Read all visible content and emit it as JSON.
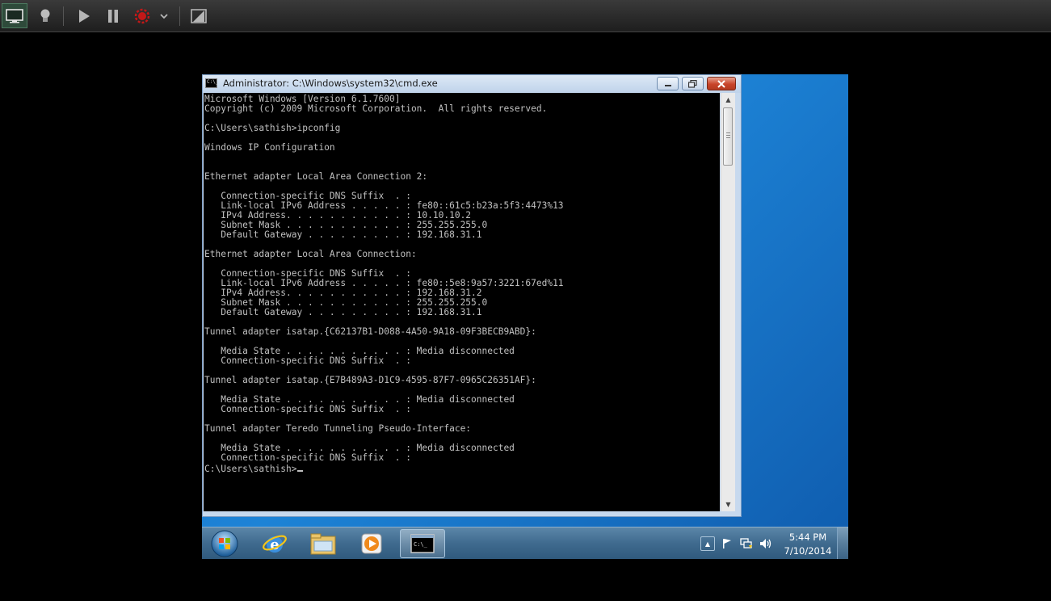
{
  "window": {
    "title": "Administrator: C:\\Windows\\system32\\cmd.exe",
    "icon_label": "C:\\_"
  },
  "console": {
    "lines": [
      "Microsoft Windows [Version 6.1.7600]",
      "Copyright (c) 2009 Microsoft Corporation.  All rights reserved.",
      "",
      "C:\\Users\\sathish>ipconfig",
      "",
      "Windows IP Configuration",
      "",
      "",
      "Ethernet adapter Local Area Connection 2:",
      "",
      "   Connection-specific DNS Suffix  . :",
      "   Link-local IPv6 Address . . . . . : fe80::61c5:b23a:5f3:4473%13",
      "   IPv4 Address. . . . . . . . . . . : 10.10.10.2",
      "   Subnet Mask . . . . . . . . . . . : 255.255.255.0",
      "   Default Gateway . . . . . . . . . : 192.168.31.1",
      "",
      "Ethernet adapter Local Area Connection:",
      "",
      "   Connection-specific DNS Suffix  . :",
      "   Link-local IPv6 Address . . . . . : fe80::5e8:9a57:3221:67ed%11",
      "   IPv4 Address. . . . . . . . . . . : 192.168.31.2",
      "   Subnet Mask . . . . . . . . . . . : 255.255.255.0",
      "   Default Gateway . . . . . . . . . : 192.168.31.1",
      "",
      "Tunnel adapter isatap.{C62137B1-D088-4A50-9A18-09F3BECB9ABD}:",
      "",
      "   Media State . . . . . . . . . . . : Media disconnected",
      "   Connection-specific DNS Suffix  . :",
      "",
      "Tunnel adapter isatap.{E7B489A3-D1C9-4595-87F7-0965C26351AF}:",
      "",
      "   Media State . . . . . . . . . . . : Media disconnected",
      "   Connection-specific DNS Suffix  . :",
      "",
      "Tunnel adapter Teredo Tunneling Pseudo-Interface:",
      "",
      "   Media State . . . . . . . . . . . : Media disconnected",
      "   Connection-specific DNS Suffix  . :",
      ""
    ],
    "prompt": "C:\\Users\\sathish>"
  },
  "taskbar": {
    "task_cmd_label": "C:\\_",
    "clock_time": "5:44 PM",
    "clock_date": "7/10/2014"
  },
  "icons": {
    "host_toolbar": [
      "monitor-icon",
      "lightbulb-icon",
      "play-icon",
      "pause-icon",
      "record-stop-icon",
      "chevron-down-icon",
      "no-screen-icon"
    ],
    "taskbar": [
      "start-orb-icon",
      "internet-explorer-icon",
      "file-explorer-icon",
      "media-player-icon",
      "cmd-icon"
    ],
    "tray": [
      "show-hidden-icons-icon",
      "action-center-flag-icon",
      "network-icon",
      "volume-icon"
    ]
  },
  "colors": {
    "console_bg": "#000000",
    "console_fg": "#c0c0c0",
    "desktop_blue": "#1d83d6",
    "close_red": "#c8452b"
  }
}
